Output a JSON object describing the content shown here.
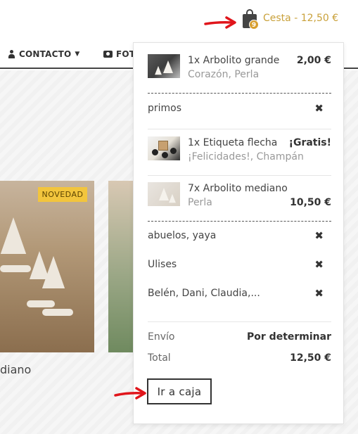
{
  "header": {
    "cart_label": "Cesta - 12,50 €",
    "cart_count": "9"
  },
  "nav": {
    "contacto": "CONTACTO",
    "fotos": "FOT"
  },
  "page": {
    "badge_new": "NOVEDAD",
    "product_name_partial": "diano"
  },
  "cart": {
    "items": [
      {
        "title": "1x Arbolito grande",
        "subtitle": "Corazón, Perla",
        "price": "2,00 €"
      },
      {
        "title": "1x Etiqueta flecha",
        "subtitle": "¡Felicidades!, Champán",
        "price": "¡Gratis!"
      },
      {
        "title": "7x Arbolito mediano",
        "subtitle": "Perla",
        "price": "10,50 €"
      }
    ],
    "notes": [
      "primos",
      "abuelos, yaya",
      "Ulises",
      "Belén, Dani, Claudia,..."
    ],
    "remove_symbol": "✖",
    "shipping_label": "Envío",
    "shipping_value": "Por determinar",
    "total_label": "Total",
    "total_value": "12,50 €",
    "checkout_label": "Ir a caja"
  },
  "colors": {
    "accent": "#c9a13b",
    "badge": "#f2c53d",
    "arrow": "#e0151b"
  },
  "icons": [
    "shopping-bag-icon",
    "person-icon",
    "camera-icon",
    "chevron-down-icon",
    "close-icon",
    "red-arrow-icon"
  ]
}
